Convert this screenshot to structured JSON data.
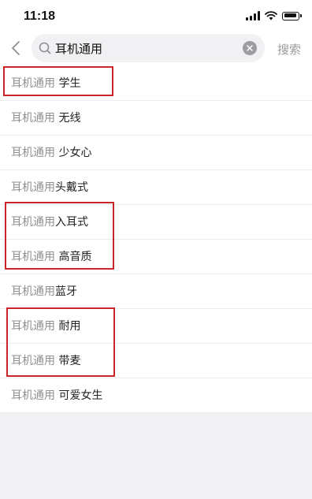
{
  "status_bar": {
    "time": "11:18",
    "icons": [
      "signal-icon",
      "wifi-icon",
      "battery-icon"
    ]
  },
  "search": {
    "back_icon": "chevron-left-icon",
    "query": "耳机通用",
    "search_button_label": "搜索"
  },
  "suggestions": [
    {
      "keyword": "耳机通用",
      "suffix": " 学生"
    },
    {
      "keyword": "耳机通用",
      "suffix": " 无线"
    },
    {
      "keyword": "耳机通用",
      "suffix": " 少女心"
    },
    {
      "keyword": "耳机通用",
      "suffix": "头戴式"
    },
    {
      "keyword": "耳机通用",
      "suffix": "入耳式"
    },
    {
      "keyword": "耳机通用",
      "suffix": " 高音质"
    },
    {
      "keyword": "耳机通用",
      "suffix": "蓝牙"
    },
    {
      "keyword": "耳机通用",
      "suffix": " 耐用"
    },
    {
      "keyword": "耳机通用",
      "suffix": " 带麦"
    },
    {
      "keyword": "耳机通用",
      "suffix": " 可爱女生"
    }
  ],
  "colors": {
    "highlight": "#c8262a",
    "keyword": "#8f8f8f",
    "background": "#f1f1f3"
  }
}
